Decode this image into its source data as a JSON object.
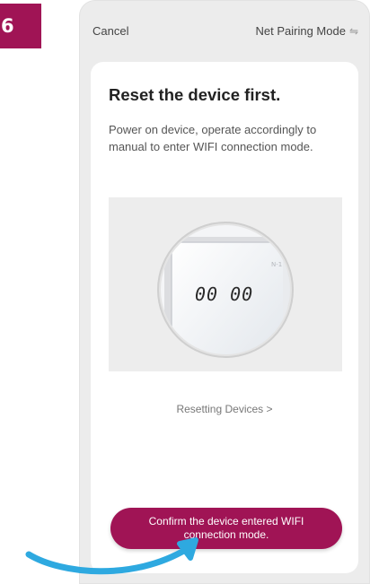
{
  "step": {
    "number": "6"
  },
  "header": {
    "cancel_label": "Cancel",
    "mode_label": "Net Pairing Mode",
    "mode_icon": "switch-arrows-icon"
  },
  "main": {
    "title": "Reset the device first.",
    "description": "Power on device, operate accordingly to manual to enter WIFI connection mode.",
    "illustration": {
      "display_text": "00 00",
      "corner_label": "N-1"
    },
    "reset_link_label": "Resetting Devices",
    "confirm_label": "Confirm the device entered WIFI connection mode."
  },
  "colors": {
    "accent": "#a01455",
    "pointer_arrow": "#2ea9e0"
  }
}
